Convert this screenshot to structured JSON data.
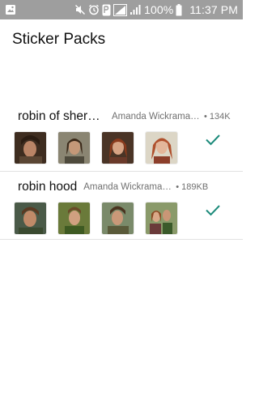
{
  "status_bar": {
    "battery_percent": "100%",
    "time": "11:37 PM",
    "icons": [
      "image-notification-icon",
      "mute-icon",
      "alarm-icon",
      "data-icon",
      "signal-icon",
      "signal-icon",
      "battery-icon"
    ]
  },
  "header": {
    "title": "Sticker Packs"
  },
  "packs": [
    {
      "name": "robin of sherwood",
      "publisher": "Amanda Wickramasinghe",
      "dot": "•",
      "size": "134K",
      "added": true
    },
    {
      "name": "robin hood",
      "publisher": "Amanda Wickramasinghe",
      "dot": "•",
      "size": "189KB",
      "added": true
    }
  ],
  "colors": {
    "status_bar": "#9e9e9e",
    "check": "#1b8a7a",
    "divider": "#e2e2e2"
  }
}
